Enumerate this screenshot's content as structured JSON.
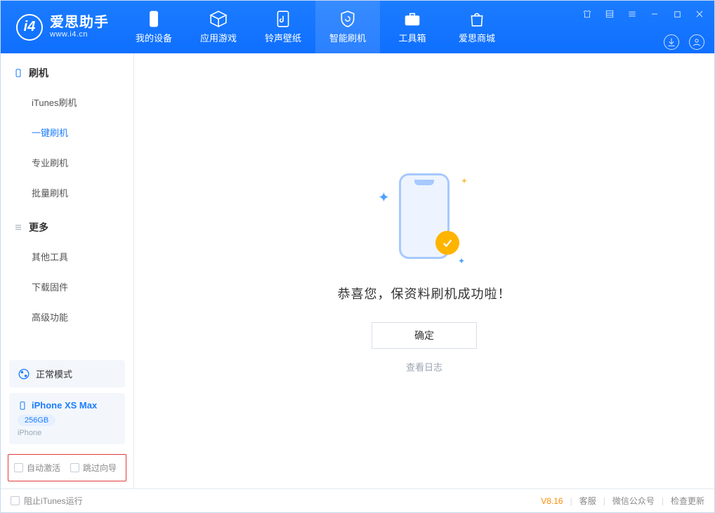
{
  "logo": {
    "title": "爱思助手",
    "subtitle": "www.i4.cn"
  },
  "tabs": {
    "device": "我的设备",
    "apps": "应用游戏",
    "ring": "铃声壁纸",
    "flash": "智能刷机",
    "tools": "工具箱",
    "store": "爱思商城"
  },
  "sidebar": {
    "section_flash": "刷机",
    "items_flash": {
      "itunes": "iTunes刷机",
      "oneclick": "一键刷机",
      "pro": "专业刷机",
      "batch": "批量刷机"
    },
    "section_more": "更多",
    "items_more": {
      "other": "其他工具",
      "firmware": "下载固件",
      "advanced": "高级功能"
    },
    "mode": "正常模式",
    "device": {
      "name": "iPhone XS Max",
      "capacity": "256GB",
      "type": "iPhone"
    },
    "opts": {
      "auto_activate": "自动激活",
      "skip_guide": "跳过向导"
    }
  },
  "main": {
    "success": "恭喜您，保资料刷机成功啦！",
    "confirm": "确定",
    "view_log": "查看日志"
  },
  "footer": {
    "block_itunes": "阻止iTunes运行",
    "version": "V8.16",
    "service": "客服",
    "wechat": "微信公众号",
    "update": "检查更新"
  }
}
